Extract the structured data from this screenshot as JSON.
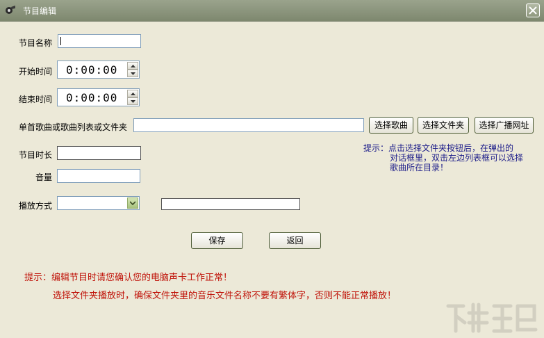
{
  "window": {
    "title": "节目编辑"
  },
  "form": {
    "name_label": "节目名称",
    "name_value": "",
    "start_label": "开始时间",
    "start_value": "0:00:00",
    "end_label": "结束时间",
    "end_value": "0:00:00",
    "file_label": "单首歌曲或歌曲列表或文件夹",
    "file_value": "",
    "btn_select_song": "选择歌曲",
    "btn_select_folder": "选择文件夹",
    "btn_select_radio": "选择广播网址",
    "duration_label": "节目时长",
    "duration_value": "",
    "volume_label": "音量",
    "volume_value": "",
    "mode_label": "播放方式",
    "mode_value": "",
    "mode_extra_value": ""
  },
  "hint_right": {
    "line1": "提示：点击选择文件夹按钮后，在弹出的",
    "line2": "对话框里，双击左边列表框可以选择",
    "line3": "歌曲所在目录！"
  },
  "actions": {
    "save": "保存",
    "back": "返回"
  },
  "hint_bottom": {
    "line1": "提示：编辑节目时请您确认您的电脑声卡工作正常！",
    "line2": "选择文件夹播放时，确保文件夹里的音乐文件名称不要有繁体字，否则不能正常播放！"
  },
  "colors": {
    "titlebar": "#8a9379",
    "hint_blue": "#1d1d8a",
    "hint_red": "#c0140a",
    "background": "#ece9d8"
  }
}
